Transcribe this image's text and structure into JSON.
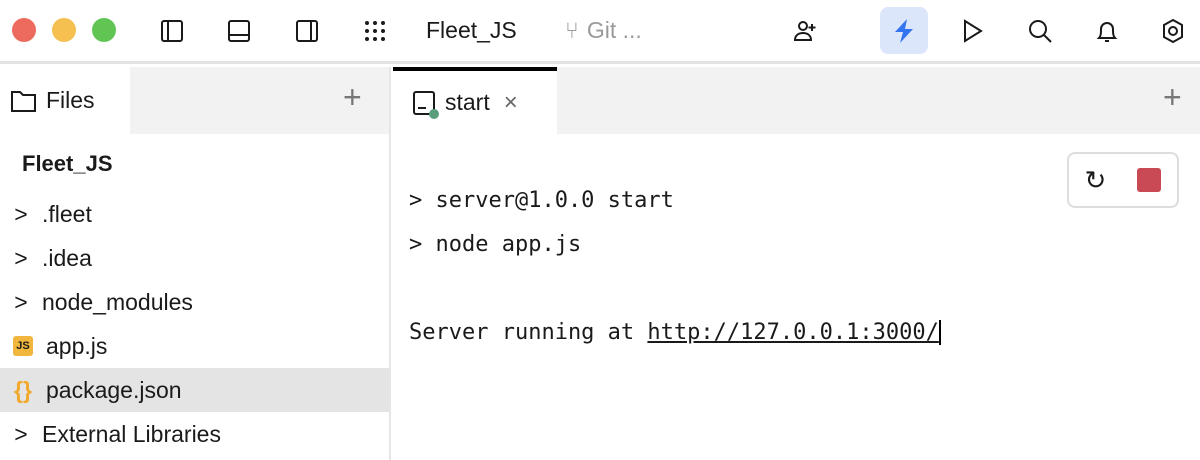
{
  "titlebar": {
    "project": "Fleet_JS",
    "git": "Git ...",
    "accent": "#3574f0"
  },
  "files_panel": {
    "tab_label": "Files",
    "root": "Fleet_JS",
    "items": [
      {
        "label": ".fleet",
        "type": "folder"
      },
      {
        "label": ".idea",
        "type": "folder"
      },
      {
        "label": "node_modules",
        "type": "folder"
      },
      {
        "label": "app.js",
        "type": "js-file",
        "badge": "JS"
      },
      {
        "label": "package.json",
        "type": "json-file",
        "selected": true
      },
      {
        "label": "External Libraries",
        "type": "folder"
      }
    ]
  },
  "terminal": {
    "tab_label": "start",
    "lines": [
      "> server@1.0.0 start",
      "> node app.js"
    ],
    "server_prefix": "Server running at ",
    "server_url": "http://127.0.0.1:3000/"
  }
}
